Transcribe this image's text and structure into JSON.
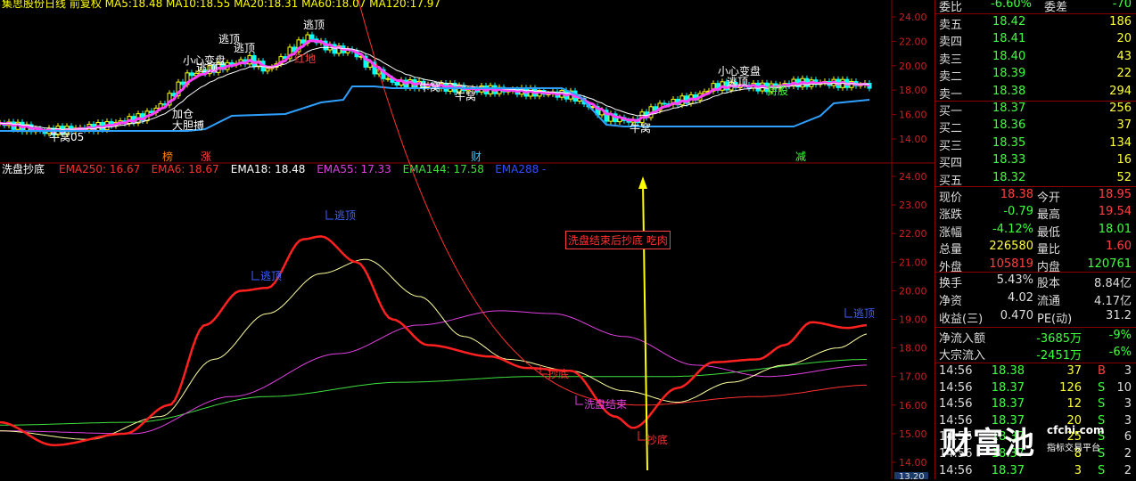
{
  "header": {
    "text": "集思股份日线 前复权  MA5:18.48  MA10:18.55  MA20:18.31  MA60:18.07  MA120:17.97"
  },
  "upper_chart": {
    "y_ticks": [
      "24.00",
      "22.00",
      "20.00",
      "18.00",
      "16.00",
      "14.00"
    ],
    "labels": {
      "escape_top": "逃顶",
      "careful": "小心变盘",
      "add": "加仓",
      "bold_buy": "大胆搏",
      "niu": "牛窝",
      "niu05": "牛窝05",
      "hongdi": "红地",
      "hold": "持股"
    },
    "markers": {
      "bang": "榜",
      "zhang": "涨",
      "cai": "财",
      "jian": "减"
    }
  },
  "lower_chart": {
    "indicator_name": "洗盘抄底",
    "legend": [
      {
        "label": "EMA250: 16.67",
        "color": "#ff3030"
      },
      {
        "label": "EMA6: 18.67",
        "color": "#ff3030"
      },
      {
        "label": "EMA18: 18.48",
        "color": "#ffffff"
      },
      {
        "label": "EMA55: 17.33",
        "color": "#e040e0"
      },
      {
        "label": "EMA144: 17.58",
        "color": "#40e040"
      },
      {
        "label": "EMA288 -",
        "color": "#3050ff"
      }
    ],
    "y_ticks": [
      "24.00",
      "23.00",
      "22.00",
      "21.00",
      "20.00",
      "19.00",
      "18.00",
      "17.00",
      "16.00",
      "15.00",
      "14.00"
    ],
    "annotations": {
      "escape_top": "逃顶",
      "bottom": "抄底",
      "wash_end": "洗盘结束",
      "note": "洗盘结束后抄底 吃肉"
    },
    "bottom_value": "13.20"
  },
  "quote_panel": {
    "top": {
      "label1": "委比",
      "value1": "-6.60%",
      "label2": "委差",
      "value2": "-70"
    },
    "asks": [
      {
        "label": "卖五",
        "price": "18.42",
        "vol": "186"
      },
      {
        "label": "卖四",
        "price": "18.41",
        "vol": "20"
      },
      {
        "label": "卖三",
        "price": "18.40",
        "vol": "43"
      },
      {
        "label": "卖二",
        "price": "18.39",
        "vol": "22"
      },
      {
        "label": "卖一",
        "price": "18.38",
        "vol": "294"
      }
    ],
    "bids": [
      {
        "label": "买一",
        "price": "18.37",
        "vol": "256"
      },
      {
        "label": "买二",
        "price": "18.36",
        "vol": "37"
      },
      {
        "label": "买三",
        "price": "18.35",
        "vol": "134"
      },
      {
        "label": "买四",
        "price": "18.33",
        "vol": "16"
      },
      {
        "label": "买五",
        "price": "18.32",
        "vol": "52"
      }
    ],
    "stats": [
      {
        "l1": "现价",
        "v1": "18.38",
        "c1": "#ff4040",
        "l2": "今开",
        "v2": "18.95",
        "c2": "#ff4040"
      },
      {
        "l1": "涨跌",
        "v1": "-0.79",
        "c1": "#40ff40",
        "l2": "最高",
        "v2": "19.54",
        "c2": "#ff4040"
      },
      {
        "l1": "涨幅",
        "v1": "-4.12%",
        "c1": "#40ff40",
        "l2": "最低",
        "v2": "18.01",
        "c2": "#40ff40"
      },
      {
        "l1": "总量",
        "v1": "226580",
        "c1": "#ffff40",
        "l2": "量比",
        "v2": "1.60",
        "c2": "#ff4040"
      },
      {
        "l1": "外盘",
        "v1": "105819",
        "c1": "#ff4040",
        "l2": "内盘",
        "v2": "120761",
        "c2": "#40ff40"
      }
    ],
    "stats2": [
      {
        "l1": "换手",
        "v1": "5.43%",
        "l2": "股本",
        "v2": "8.84亿"
      },
      {
        "l1": "净资",
        "v1": "4.02",
        "l2": "流通",
        "v2": "4.17亿"
      },
      {
        "l1": "收益(三)",
        "v1": "0.470",
        "l2": "PE(动)",
        "v2": "31.2"
      }
    ],
    "flows": [
      {
        "label": "净流入额",
        "value": "-3685万",
        "pct": "-9%"
      },
      {
        "label": "大宗流入",
        "value": "-2451万",
        "pct": "-6%"
      }
    ],
    "ticks": [
      {
        "time": "14:56",
        "price": "18.38",
        "vol": "37",
        "side": "B",
        "n": "3"
      },
      {
        "time": "14:56",
        "price": "18.37",
        "vol": "126",
        "side": "S",
        "n": "10"
      },
      {
        "time": "14:56",
        "price": "18.37",
        "vol": "12",
        "side": "S",
        "n": "3"
      },
      {
        "time": "14:56",
        "price": "18.37",
        "vol": "20",
        "side": "S",
        "n": "3"
      },
      {
        "time": "14:56",
        "price": "18.37",
        "vol": "25",
        "side": "S",
        "n": "6"
      },
      {
        "time": "14:56",
        "price": "18.37",
        "vol": "8",
        "side": "S",
        "n": "2"
      },
      {
        "time": "14:56",
        "price": "18.37",
        "vol": "3",
        "side": "S",
        "n": "2"
      }
    ]
  },
  "watermark": {
    "big": "财富池",
    "url": "cfchi.com",
    "sub": "指标交易平台"
  }
}
